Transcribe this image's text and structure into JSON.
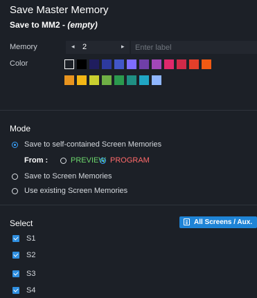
{
  "header": {
    "title": "Save Master Memory",
    "subtitle_prefix": "Save to MM2 - ",
    "subtitle_state": "(empty)"
  },
  "memory": {
    "label": "Memory",
    "prev_icon": "chevron-left-icon",
    "next_icon": "chevron-right-icon",
    "prev_glyph": "◂",
    "next_glyph": "▸",
    "value": "2",
    "label_value": "",
    "label_placeholder": "Enter label"
  },
  "color": {
    "label": "Color",
    "swatches": [
      "#1c2027",
      "#000000",
      "#1f1d5e",
      "#2d3a9e",
      "#4256c9",
      "#7f6dff",
      "#6f3fa8",
      "#a347b8",
      "#e0286c",
      "#d02a48",
      "#e23f2a",
      "#f25a13",
      "#e8941f",
      "#f3b615",
      "#c9cf2f",
      "#6faf45",
      "#2b9a4e",
      "#1f8f83",
      "#20a6c4",
      "#8fb6ff"
    ],
    "selected_index": 0
  },
  "mode": {
    "title": "Mode",
    "options": [
      {
        "label": "Save to self-contained Screen Memories",
        "selected": true
      },
      {
        "label": "Save to Screen Memories",
        "selected": false
      },
      {
        "label": "Use existing Screen Memories",
        "selected": false
      }
    ],
    "from_label": "From :",
    "preview_label": "PREVIEW",
    "program_label": "PROGRAM",
    "from_selected": "PROGRAM"
  },
  "select": {
    "title": "Select",
    "all_button_label": "All Screens / Aux.",
    "all_button_icon": "list-icon",
    "screens": [
      {
        "label": "S1",
        "checked": true
      },
      {
        "label": "S2",
        "checked": true
      },
      {
        "label": "S3",
        "checked": true
      },
      {
        "label": "S4",
        "checked": true
      }
    ]
  },
  "colors": {
    "accent": "#3aa3ff",
    "button": "#1f84d6",
    "preview": "#6cd66c",
    "program": "#ff6a6a",
    "background": "#1c2027"
  }
}
